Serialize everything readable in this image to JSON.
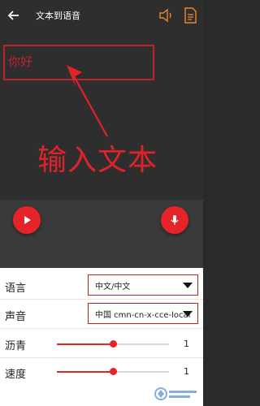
{
  "header": {
    "title": "文本到语音",
    "icons": {
      "back": "arrow-left",
      "speak": "speaker",
      "file": "document"
    }
  },
  "editor": {
    "value": "你好",
    "annotation": "输入文本"
  },
  "actions": {
    "play": "play-icon",
    "mic": "microphone-icon"
  },
  "settings": {
    "language": {
      "label": "语言",
      "value": "中文/中文"
    },
    "voice": {
      "label": "声音",
      "value": "中国 cmn-cn-x-cce-local"
    },
    "pitch": {
      "label": "沥青",
      "value": "1",
      "level": 0.5
    },
    "speed": {
      "label": "速度",
      "value": "1",
      "level": 0.5
    }
  },
  "colors": {
    "accent": "#e52329",
    "annotation": "#e0232b"
  }
}
